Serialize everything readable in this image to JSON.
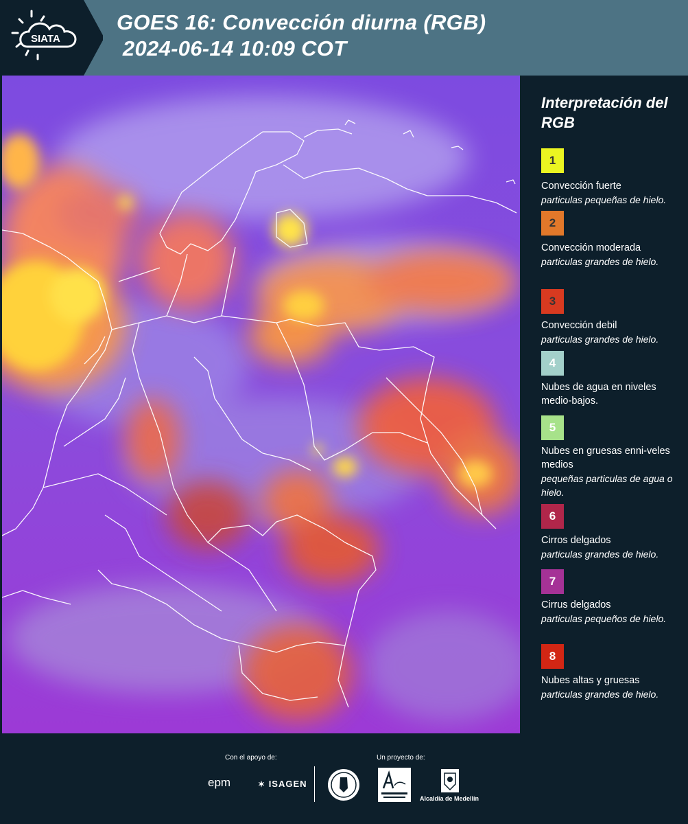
{
  "header": {
    "logo_text": "SIATA",
    "title_line1": "GOES 16: Convección diurna (RGB)",
    "title_line2": " 2024-06-14 10:09 COT",
    "bg_color": "#4d7384"
  },
  "legend": {
    "title": "Interpretación del RGB",
    "items": [
      {
        "number": "1",
        "color": "#ebf521",
        "text_color": "#333333",
        "label": "Convección fuerte",
        "sub": "particulas pequeñas de hielo."
      },
      {
        "number": "2",
        "color": "#e2782a",
        "text_color": "#333333",
        "label": "Convección moderada",
        "sub": "particulas grandes de hielo."
      },
      {
        "number": "3",
        "color": "#d83a20",
        "text_color": "#333333",
        "label": "Convección debil",
        "sub": "particulas grandes de hielo."
      },
      {
        "number": "4",
        "color": "#a3d0ca",
        "text_color": "#ffffff",
        "label": "Nubes de agua en niveles medio-bajos.",
        "sub": ""
      },
      {
        "number": "5",
        "color": "#a7e28a",
        "text_color": "#ffffff",
        "label": "Nubes en gruesas enni-veles medios",
        "sub": "pequeñas particulas de agua o hielo."
      },
      {
        "number": "6",
        "color": "#b0264a",
        "text_color": "#ffffff",
        "label": "Cirros delgados",
        "sub": "particulas grandes de hielo."
      },
      {
        "number": "7",
        "color": "#a53296",
        "text_color": "#ffffff",
        "label": "Cirrus delgados",
        "sub": "particulas pequeños de hielo."
      },
      {
        "number": "8",
        "color": "#d22614",
        "text_color": "#ffffff",
        "label": "Nubes altas y gruesas",
        "sub": "particulas grandes de hielo."
      }
    ]
  },
  "footer": {
    "support_label": "Con el apoyo de:",
    "project_label": "Un proyecto de:",
    "sponsor1": "epm",
    "sponsor2": "ISAGEN",
    "partner3": "Alcaldía de Medellín"
  }
}
